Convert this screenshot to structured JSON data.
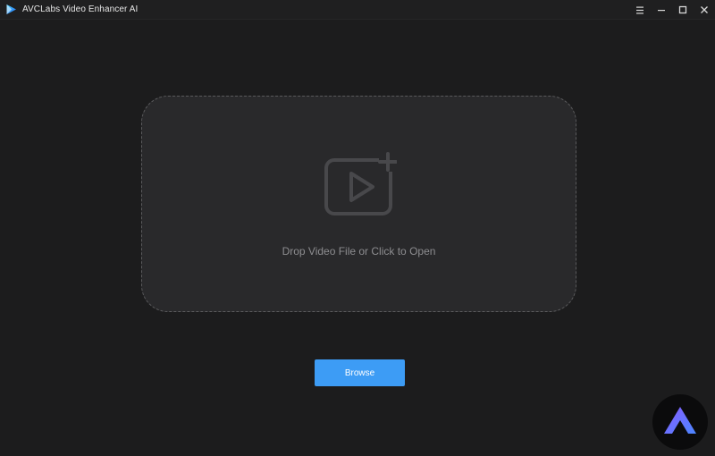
{
  "window": {
    "title": "AVCLabs Video Enhancer AI",
    "logo_icon": "play-triangle-logo-icon",
    "controls": [
      {
        "name": "menu-icon"
      },
      {
        "name": "minimize-icon"
      },
      {
        "name": "maximize-icon"
      },
      {
        "name": "close-icon"
      }
    ]
  },
  "drop_zone": {
    "icon": "video-add-icon",
    "text": "Drop Video File or Click to Open"
  },
  "browse": {
    "label": "Browse"
  },
  "badge": {
    "icon": "brand-a-logo-icon"
  },
  "colors": {
    "background": "#1c1c1d",
    "drop_zone_fill": "#29292b",
    "accent": "#3d9cf5",
    "badge_gradient_start": "#7a5cff",
    "badge_gradient_end": "#4b86ff"
  }
}
